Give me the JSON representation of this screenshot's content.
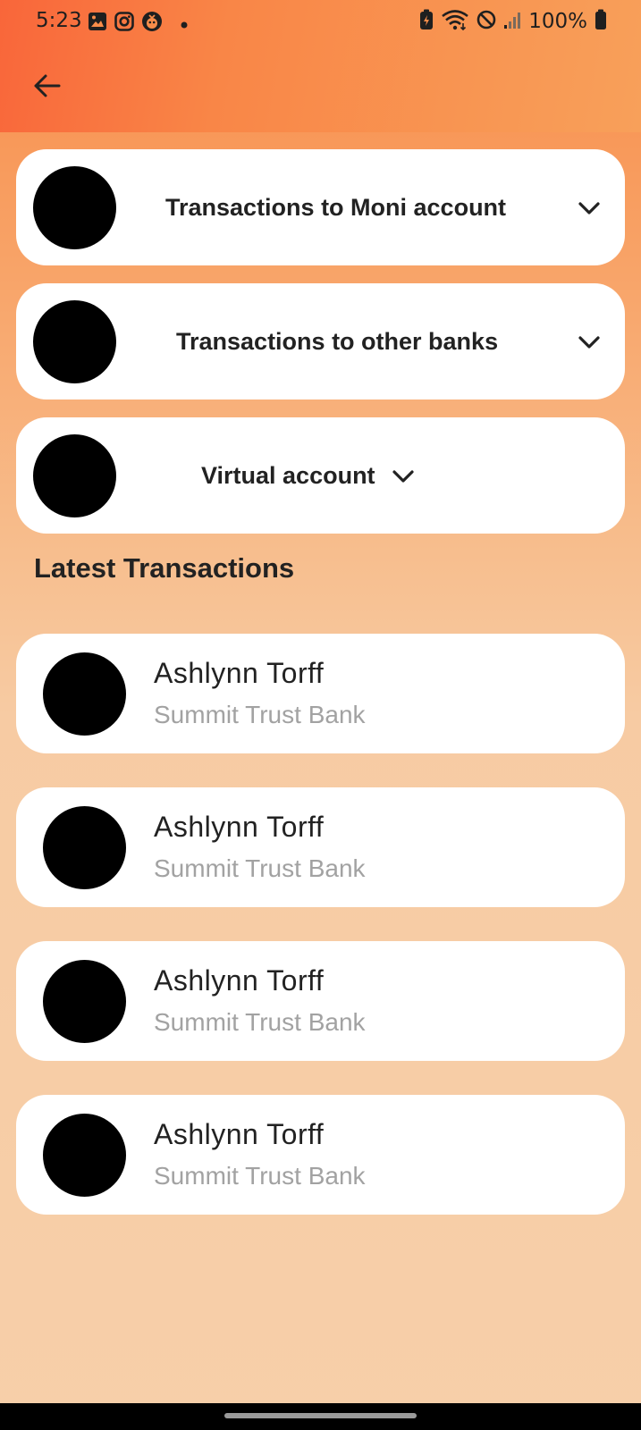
{
  "status_bar": {
    "time": "5:23",
    "battery": "100%",
    "left_icons": [
      "gallery-icon",
      "instagram-icon",
      "app-icon",
      "dot-icon"
    ],
    "right_icons": [
      "battery-saver-icon",
      "wifi-icon",
      "do-not-disturb-icon",
      "signal-icon",
      "battery-icon"
    ]
  },
  "app_bar": {
    "back_icon": "arrow-left-icon"
  },
  "menu": {
    "items": [
      {
        "label": "Transactions to Moni account",
        "icon": "chevron-down-icon"
      },
      {
        "label": "Transactions to other banks",
        "icon": "chevron-down-icon"
      },
      {
        "label": "Virtual account",
        "icon": "chevron-down-icon"
      }
    ]
  },
  "latest": {
    "title": "Latest Transactions",
    "transactions": [
      {
        "name": "Ashlynn Torff",
        "bank": "Summit Trust Bank"
      },
      {
        "name": "Ashlynn Torff",
        "bank": "Summit Trust Bank"
      },
      {
        "name": "Ashlynn Torff",
        "bank": "Summit Trust Bank"
      },
      {
        "name": "Ashlynn Torff",
        "bank": "Summit Trust Bank"
      }
    ]
  },
  "colors": {
    "accent_start": "#f9663a",
    "accent_end": "#f8a05a",
    "background": "#f7cfa9",
    "card": "#ffffff",
    "avatar": "#000000"
  }
}
